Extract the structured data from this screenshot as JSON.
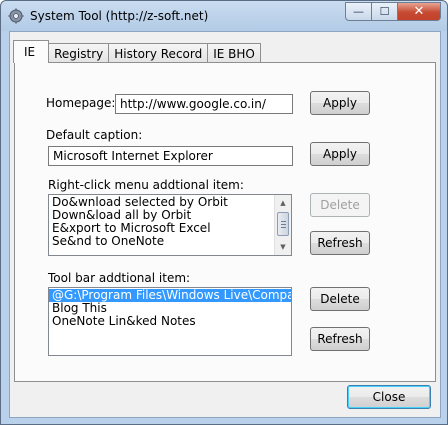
{
  "window": {
    "title": "System Tool (http://z-soft.net)",
    "min_glyph": "—",
    "max_glyph": "☐",
    "close_glyph": "✕"
  },
  "tabs": [
    {
      "label": "IE",
      "active": true
    },
    {
      "label": "Registry",
      "active": false
    },
    {
      "label": "History Record",
      "active": false
    },
    {
      "label": "IE BHO",
      "active": false
    }
  ],
  "ie": {
    "homepage_label": "Homepage:",
    "homepage_value": "http://www.google.co.in/",
    "homepage_apply": "Apply",
    "caption_label": "Default caption:",
    "caption_value": "Microsoft Internet Explorer",
    "caption_apply": "Apply",
    "rightclick_label": "Right-click menu addtional item:",
    "rightclick_items": [
      "Do&wnload selected by Orbit",
      "Down&load all by Orbit",
      "E&xport to Microsoft Excel",
      "Se&nd to OneNote"
    ],
    "rightclick_delete": "Delete",
    "rightclick_refresh": "Refresh",
    "toolbar_label": "Tool bar addtional item:",
    "toolbar_items": [
      "@G:\\Program Files\\Windows Live\\Companion\\",
      "Blog This",
      "OneNote Lin&ked Notes"
    ],
    "toolbar_delete": "Delete",
    "toolbar_refresh": "Refresh"
  },
  "footer": {
    "close_label": "Close"
  },
  "colors": {
    "selection": "#3399ff",
    "titlebar": "#b9d1ea",
    "close_button": "#c74a32"
  }
}
